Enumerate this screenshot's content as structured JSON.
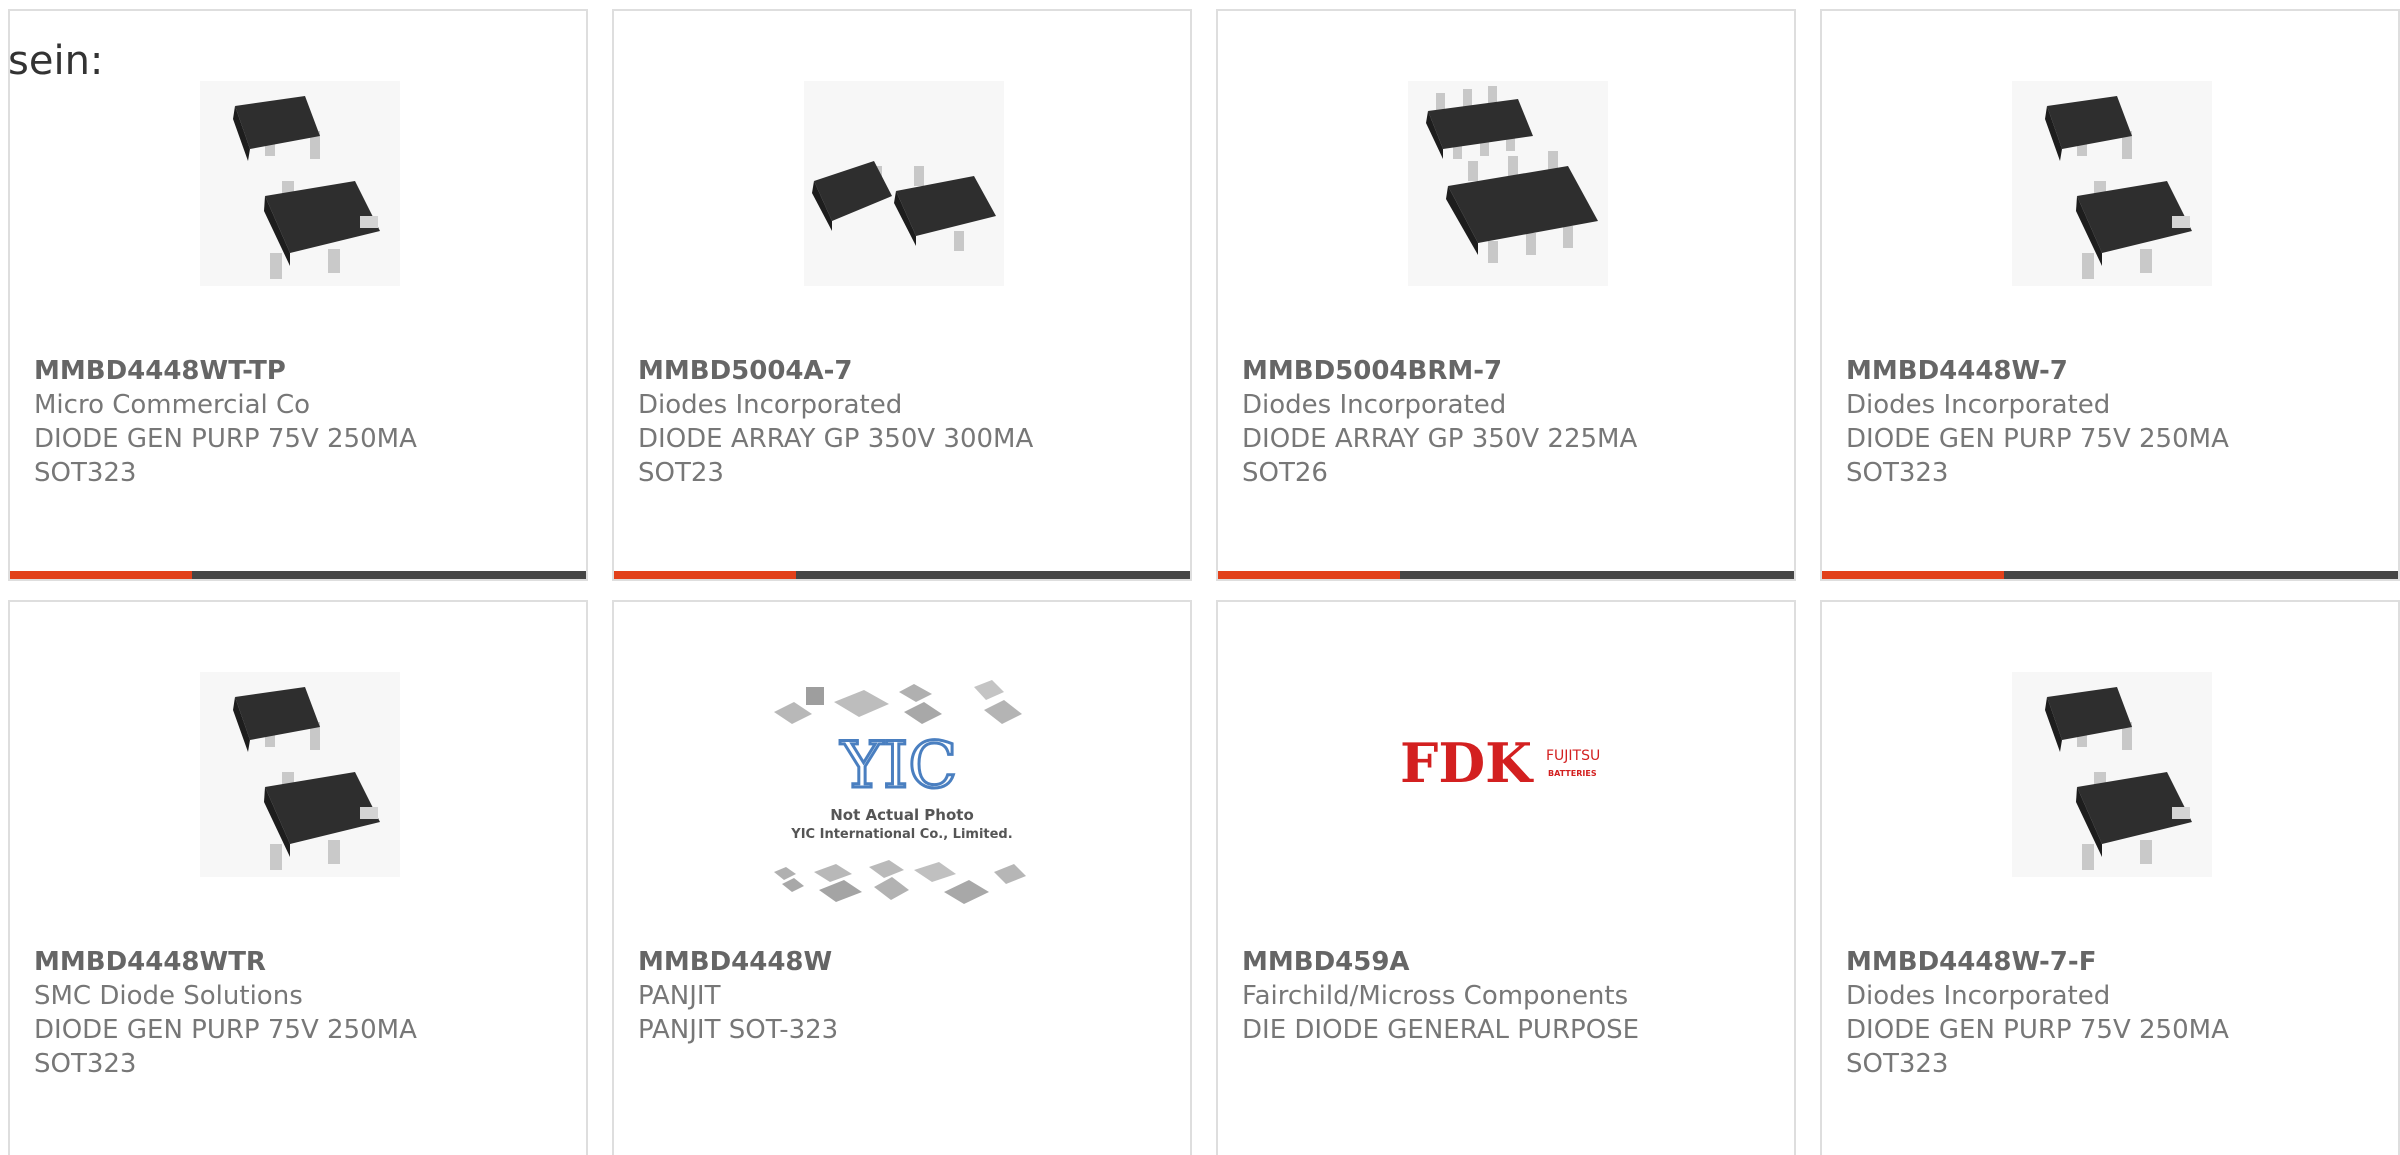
{
  "intro": {
    "text": "sein:"
  },
  "colors": {
    "accent": "#e2401a",
    "bar": "#454545",
    "border": "#dedede",
    "text": "#777777"
  },
  "products": [
    {
      "part": "MMBD4448WT-TP",
      "maker": "Micro Commercial Co",
      "desc": "DIODE GEN PURP 75V 250MA",
      "pkg": "SOT323",
      "image": "sot323-package-icon"
    },
    {
      "part": "MMBD5004A-7",
      "maker": "Diodes Incorporated",
      "desc": "DIODE ARRAY GP 350V 300MA",
      "pkg": "SOT23",
      "image": "sot23-package-icon"
    },
    {
      "part": "MMBD5004BRM-7",
      "maker": "Diodes Incorporated",
      "desc": "DIODE ARRAY GP 350V 225MA",
      "pkg": "SOT26",
      "image": "sot26-package-icon"
    },
    {
      "part": "MMBD4448W-7",
      "maker": "Diodes Incorporated",
      "desc": "DIODE GEN PURP 75V 250MA",
      "pkg": "SOT323",
      "image": "sot323-package-icon"
    },
    {
      "part": "MMBD4448WTR",
      "maker": "SMC Diode Solutions",
      "desc": "DIODE GEN PURP 75V 250MA",
      "pkg": "SOT323",
      "image": "sot323-package-icon"
    },
    {
      "part": "MMBD4448W",
      "maker": "PANJIT",
      "desc": "PANJIT SOT-323",
      "pkg": "",
      "image": "yic-placeholder-icon",
      "image_text": {
        "logo": "YIC",
        "line1": "Not Actual Photo",
        "line2": "YIC International Co., Limited."
      }
    },
    {
      "part": "MMBD459A",
      "maker": "Fairchild/Micross Components",
      "desc": "DIE DIODE GENERAL PURPOSE",
      "pkg": "",
      "image": "fdk-logo-icon",
      "image_text": {
        "logo": "FDK",
        "brand": "FUJITSU",
        "sub": "BATTERIES"
      }
    },
    {
      "part": "MMBD4448W-7-F",
      "maker": "Diodes Incorporated",
      "desc": "DIODE GEN PURP 75V 250MA",
      "pkg": "SOT323",
      "image": "sot323-package-icon"
    }
  ]
}
